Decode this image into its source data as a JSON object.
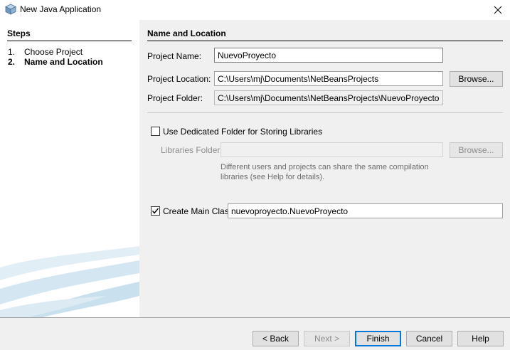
{
  "window": {
    "title": "New Java Application"
  },
  "steps": {
    "header": "Steps",
    "items": [
      {
        "number": "1.",
        "label": "Choose Project"
      },
      {
        "number": "2.",
        "label": "Name and Location"
      }
    ]
  },
  "name_location": {
    "header": "Name and Location",
    "project_name": {
      "label": "Project Name:",
      "value": "NuevoProyecto"
    },
    "project_location": {
      "label": "Project Location:",
      "value": "C:\\Users\\mj\\Documents\\NetBeansProjects",
      "browse_label": "Browse..."
    },
    "project_folder": {
      "label": "Project Folder:",
      "value": "C:\\Users\\mj\\Documents\\NetBeansProjects\\NuevoProyecto"
    }
  },
  "libraries": {
    "dedicated_folder_label": "Use Dedicated Folder for Storing Libraries",
    "dedicated_folder_checked": false,
    "folder_label": "Libraries Folder:",
    "folder_value": "",
    "browse_label": "Browse...",
    "note_line1": "Different users and projects can share the same compilation",
    "note_line2": "libraries (see Help for details)."
  },
  "main_class": {
    "label": "Create Main Class",
    "checked": true,
    "value": "nuevoproyecto.NuevoProyecto"
  },
  "footer": {
    "back": "< Back",
    "next": "Next >",
    "finish": "Finish",
    "cancel": "Cancel",
    "help": "Help"
  },
  "icons": {
    "app": "netbeans-cube-icon",
    "close": "close-icon",
    "checkmark": "checkmark-icon"
  },
  "colors": {
    "panel": "#f0f0f0",
    "accent": "#0078d7",
    "swoosh": "#cfe3ef"
  }
}
